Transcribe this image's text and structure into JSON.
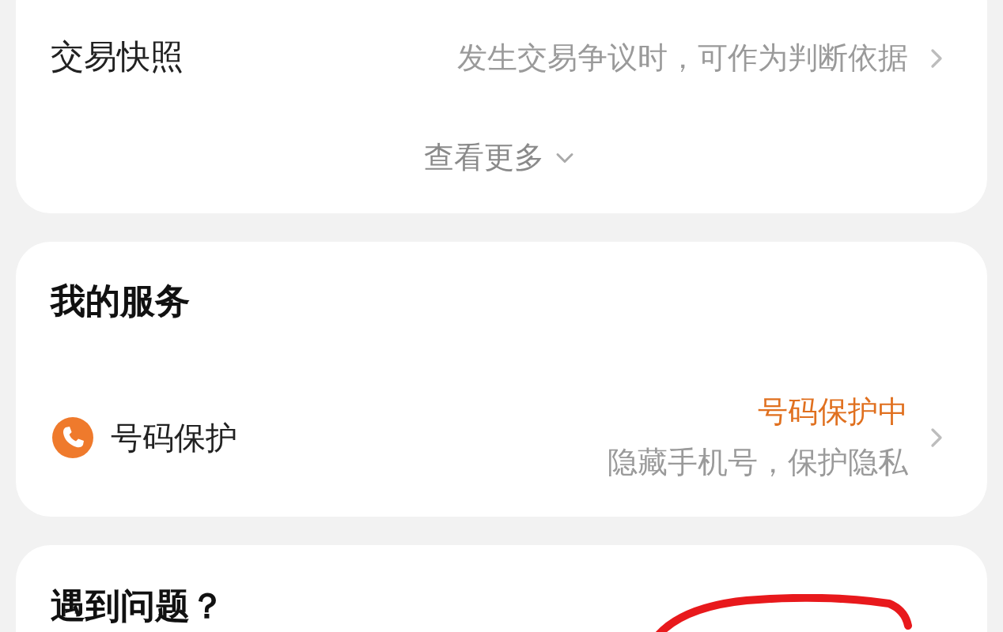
{
  "snapshot_row": {
    "label": "交易快照",
    "hint": "发生交易争议时，可作为判断依据"
  },
  "more_link": "查看更多",
  "services": {
    "title": "我的服务",
    "items": [
      {
        "label": "号码保护",
        "status": "号码保护中",
        "description": "隐藏手机号，保护隐私"
      }
    ]
  },
  "help": {
    "title": "遇到问题？"
  }
}
